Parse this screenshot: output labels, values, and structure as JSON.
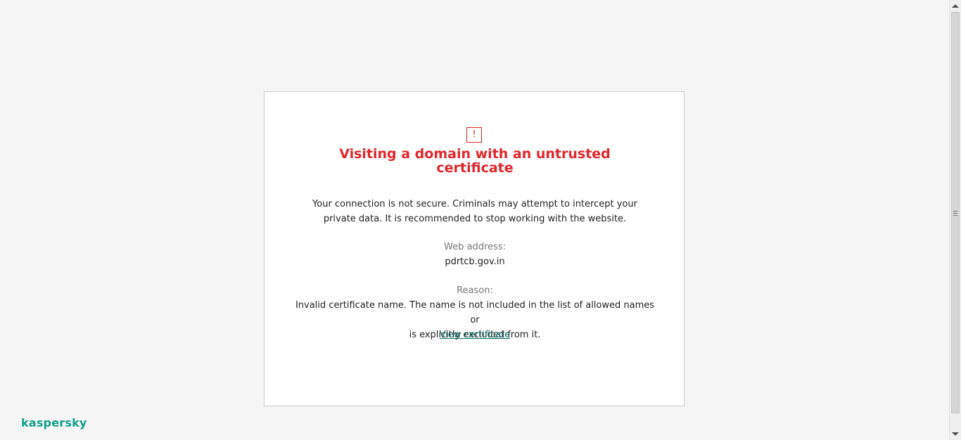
{
  "alert": {
    "icon": "exclamation-icon",
    "icon_glyph": "!",
    "title_line1": "Visiting a domain with an untrusted",
    "title_line2": "certificate",
    "description": "Your connection is not secure. Criminals may attempt to intercept your private data. It is recommended to stop working with the website.",
    "web_address_label": "Web address:",
    "web_address": "pdrtcb.gov.in",
    "reason_label": "Reason:",
    "reason_line1": "Invalid certificate name. The name is not included in the list of allowed names or",
    "reason_line2": "is explicitly excluded from it.",
    "view_certificate_label": "View certificate"
  },
  "branding": {
    "logo_text": "kaspersky"
  },
  "colors": {
    "accent": "#e0262c",
    "link": "#0b6a67",
    "brand": "#10a08a",
    "background": "#f5f5f5"
  }
}
